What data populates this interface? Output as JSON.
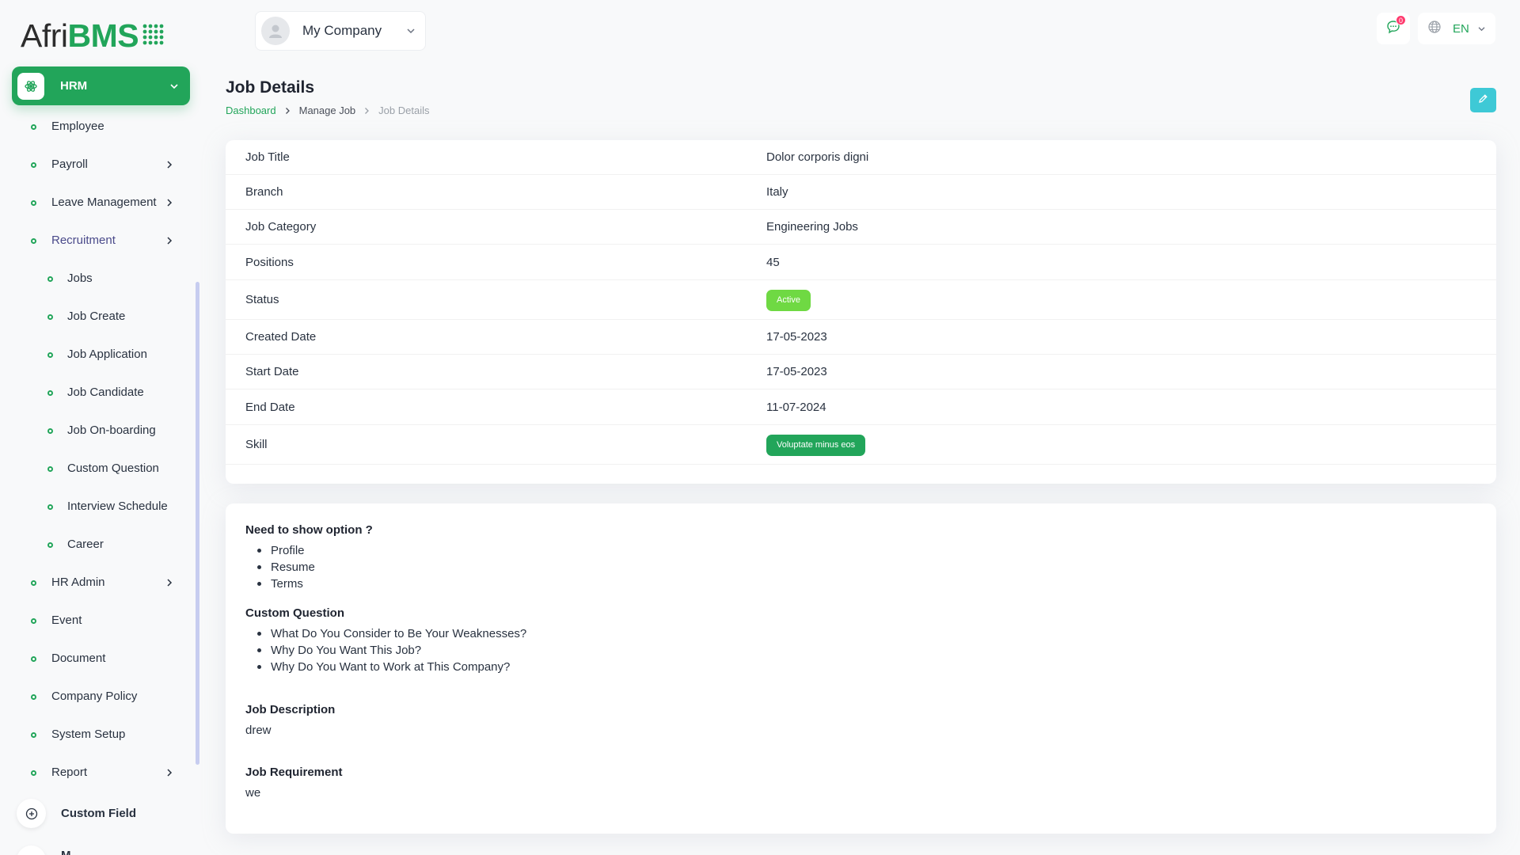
{
  "brand": {
    "logo_prefix": "Afri",
    "logo_suffix": "BMS"
  },
  "sidebar": {
    "active_module": "HRM",
    "items": [
      {
        "label": "Employee",
        "sub": false,
        "has_children": false
      },
      {
        "label": "Payroll",
        "sub": false,
        "has_children": true
      },
      {
        "label": "Leave Management",
        "sub": false,
        "has_children": true
      },
      {
        "label": "Recruitment",
        "sub": false,
        "has_children": true,
        "active": true
      },
      {
        "label": "Jobs",
        "sub": true
      },
      {
        "label": "Job Create",
        "sub": true
      },
      {
        "label": "Job Application",
        "sub": true
      },
      {
        "label": "Job Candidate",
        "sub": true
      },
      {
        "label": "Job On-boarding",
        "sub": true
      },
      {
        "label": "Custom Question",
        "sub": true
      },
      {
        "label": "Interview Schedule",
        "sub": true
      },
      {
        "label": "Career",
        "sub": true
      },
      {
        "label": "HR Admin",
        "sub": false,
        "has_children": true
      },
      {
        "label": "Event",
        "sub": false,
        "has_children": false
      },
      {
        "label": "Document",
        "sub": false,
        "has_children": false
      },
      {
        "label": "Company Policy",
        "sub": false,
        "has_children": false
      },
      {
        "label": "System Setup",
        "sub": false,
        "has_children": false
      },
      {
        "label": "Report",
        "sub": false,
        "has_children": true
      }
    ],
    "custom_field_label": "Custom Field",
    "next_module_label": "M"
  },
  "header": {
    "company_name": "My Company",
    "message_count": "0",
    "language": "EN"
  },
  "page": {
    "title": "Job Details",
    "breadcrumb": [
      "Dashboard",
      "Manage Job",
      "Job Details"
    ]
  },
  "details": [
    {
      "key": "Job Title",
      "value": "Dolor corporis digni"
    },
    {
      "key": "Branch",
      "value": "Italy"
    },
    {
      "key": "Job Category",
      "value": "Engineering Jobs"
    },
    {
      "key": "Positions",
      "value": "45"
    },
    {
      "key": "Status",
      "value": "Active",
      "pill": "active"
    },
    {
      "key": "Created Date",
      "value": "17-05-2023"
    },
    {
      "key": "Start Date",
      "value": "17-05-2023"
    },
    {
      "key": "End Date",
      "value": "11-07-2024"
    },
    {
      "key": "Skill",
      "value": "Voluptate minus eos",
      "pill": "skill"
    }
  ],
  "options": {
    "show_title": "Need to show option ?",
    "show_items": [
      "Profile",
      "Resume",
      "Terms"
    ],
    "custom_question_title": "Custom Question",
    "custom_questions": [
      "What Do You Consider to Be Your Weaknesses?",
      "Why Do You Want This Job?",
      "Why Do You Want to Work at This Company?"
    ],
    "description_title": "Job Description",
    "description": "drew",
    "requirement_title": "Job Requirement",
    "requirement": "we"
  },
  "colors": {
    "brand_green": "#22a55a",
    "active_pill": "#6fd943",
    "edit_button": "#3ec9d6",
    "badge": "#ff3a6e"
  },
  "icons": {
    "hrm": "atom-icon",
    "company_avatar": "user-avatar-icon",
    "messages": "message-icon",
    "language": "globe-icon",
    "edit": "pencil-icon",
    "custom_field": "plus-circle-icon"
  }
}
